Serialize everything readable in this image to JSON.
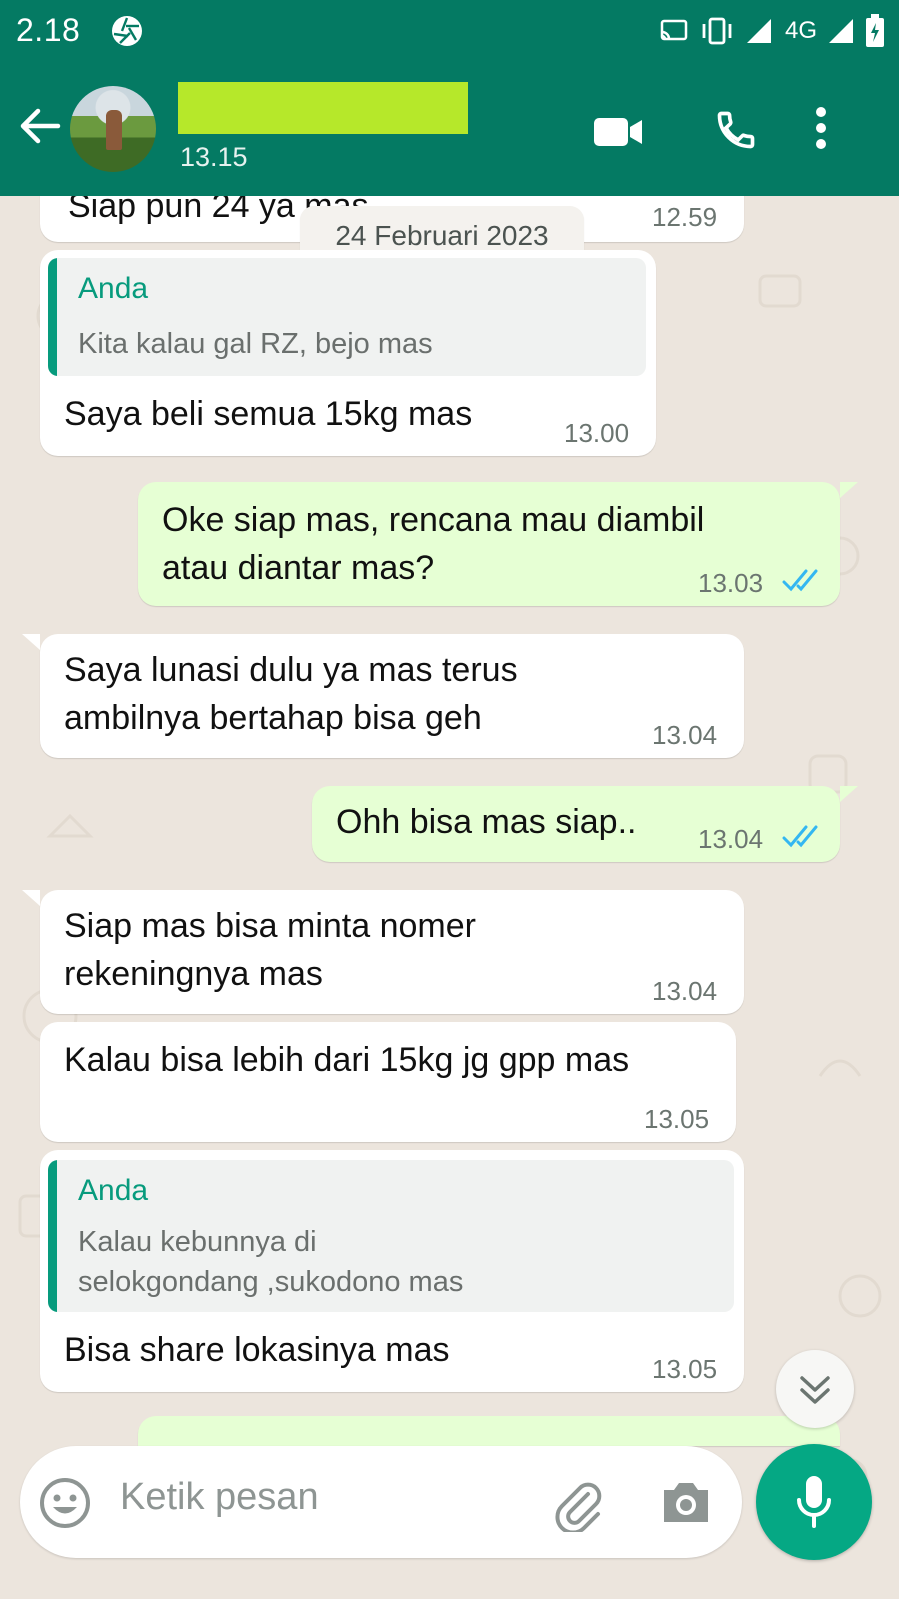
{
  "status_bar": {
    "time": "2.18",
    "network": "4G"
  },
  "header": {
    "last_seen": "13.15"
  },
  "date_chip": "24 Februari 2023",
  "messages": {
    "m0": {
      "text": "Siap pun 24 ya mas",
      "time": "12.59"
    },
    "m1": {
      "quote_author": "Anda",
      "quote_text": "Kita kalau gal RZ, bejo mas",
      "text": "Saya beli semua 15kg mas",
      "time": "13.00"
    },
    "m2": {
      "line1": "Oke siap mas, rencana mau diambil",
      "line2": "atau diantar mas?",
      "time": "13.03"
    },
    "m3": {
      "line1": "Saya lunasi dulu ya mas terus",
      "line2": "ambilnya bertahap bisa geh",
      "time": "13.04"
    },
    "m4": {
      "text": "Ohh bisa mas siap..",
      "time": "13.04"
    },
    "m5": {
      "line1": "Siap mas bisa minta nomer",
      "line2": "rekeningnya mas",
      "time": "13.04"
    },
    "m6": {
      "text": "Kalau bisa lebih dari 15kg jg gpp mas",
      "time": "13.05"
    },
    "m7": {
      "quote_author": "Anda",
      "quote_line1": "Kalau kebunnya di",
      "quote_line2": "selokgondang ,sukodono mas",
      "text": "Bisa share lokasinya mas",
      "time": "13.05"
    }
  },
  "input": {
    "placeholder": "Ketik pesan"
  },
  "colors": {
    "header": "#047a63",
    "accent": "#05a884",
    "outgoing": "#e6ffd4",
    "read_ticks": "#34b7f1"
  }
}
